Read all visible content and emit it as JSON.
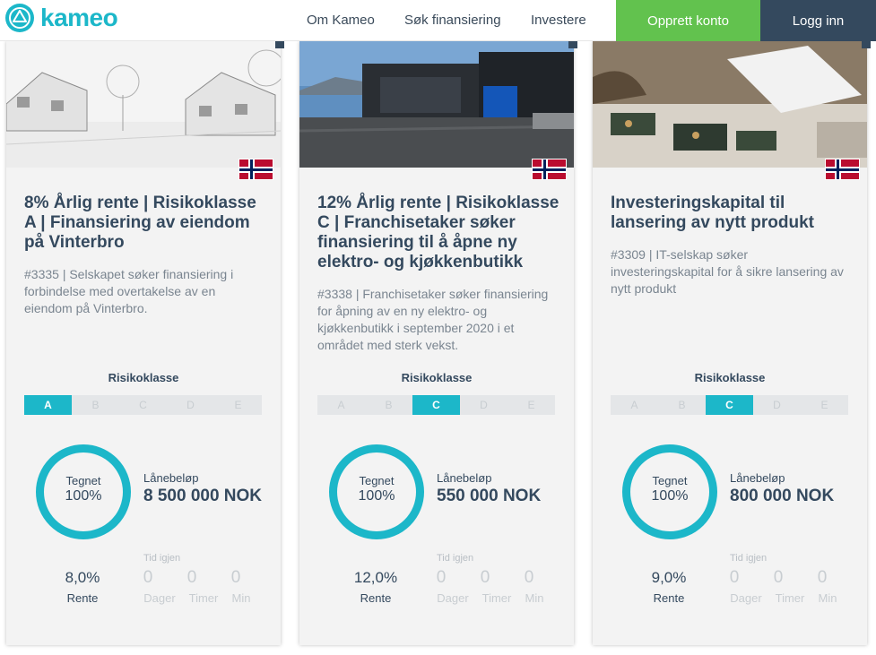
{
  "header": {
    "logo_text": "kameo",
    "nav": [
      "Om Kameo",
      "Søk finansiering",
      "Investere"
    ],
    "create_account": "Opprett konto",
    "login": "Logg inn"
  },
  "colors": {
    "accent": "#1cb7c9",
    "green": "#62c24e",
    "navy": "#34495e"
  },
  "cards": [
    {
      "title": "8% Årlig rente | Risikoklasse A | Finansiering av eiendom på Vinterbro",
      "description": "#3335 | Selskapet søker finansiering i forbindelse med overtakelse av en eiendom på Vinterbro.",
      "risk_label": "Risikoklasse",
      "risk_classes": [
        "A",
        "B",
        "C",
        "D",
        "E"
      ],
      "risk_active": "A",
      "subscribed_label": "Tegnet",
      "subscribed_value": "100%",
      "subscribed_fraction": 1.0,
      "loan_label": "Lånebeløp",
      "loan_value": "8 500 000 NOK",
      "rate_value": "8,0%",
      "rate_label": "Rente",
      "time_label": "Tid igjen",
      "time_values": [
        "0",
        "0",
        "0"
      ],
      "time_units": [
        "Dager",
        "Timer",
        "Min"
      ]
    },
    {
      "title": "12% Årlig rente | Risikoklasse C | Franchisetaker søker finansiering til å åpne ny elektro- og kjøkkenbutikk",
      "description": "#3338 | Franchisetaker søker finansiering for åpning av en ny elektro- og kjøkkenbutikk i september 2020 i et området med sterk vekst.",
      "risk_label": "Risikoklasse",
      "risk_classes": [
        "A",
        "B",
        "C",
        "D",
        "E"
      ],
      "risk_active": "C",
      "subscribed_label": "Tegnet",
      "subscribed_value": "100%",
      "subscribed_fraction": 1.0,
      "loan_label": "Lånebeløp",
      "loan_value": "550 000 NOK",
      "rate_value": "12,0%",
      "rate_label": "Rente",
      "time_label": "Tid igjen",
      "time_values": [
        "0",
        "0",
        "0"
      ],
      "time_units": [
        "Dager",
        "Timer",
        "Min"
      ]
    },
    {
      "title": "Investeringskapital til lansering av nytt produkt",
      "description": "#3309 | IT-selskap søker investeringskapital for å sikre lansering av nytt produkt",
      "risk_label": "Risikoklasse",
      "risk_classes": [
        "A",
        "B",
        "C",
        "D",
        "E"
      ],
      "risk_active": "C",
      "subscribed_label": "Tegnet",
      "subscribed_value": "100%",
      "subscribed_fraction": 1.0,
      "loan_label": "Lånebeløp",
      "loan_value": "800 000 NOK",
      "rate_value": "9,0%",
      "rate_label": "Rente",
      "time_label": "Tid igjen",
      "time_values": [
        "0",
        "0",
        "0"
      ],
      "time_units": [
        "Dager",
        "Timer",
        "Min"
      ]
    }
  ]
}
